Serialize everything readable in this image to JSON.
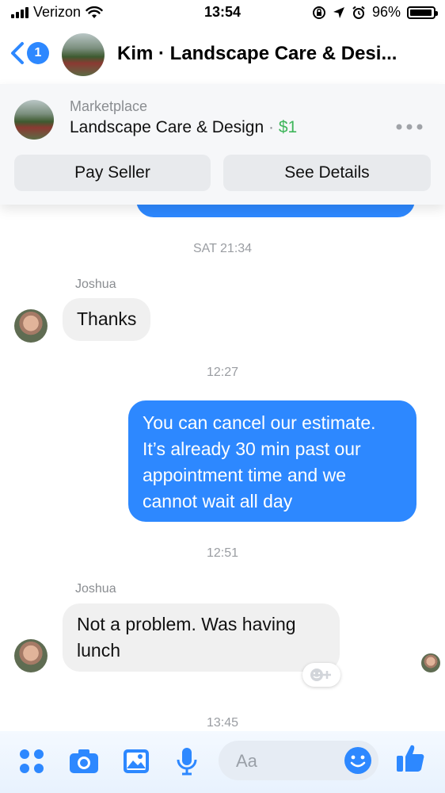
{
  "status_bar": {
    "carrier": "Verizon",
    "time": "13:54",
    "battery": "96%",
    "battery_level": 0.96
  },
  "header": {
    "unread_badge": "1",
    "title": "Kim · Landscape Care & Desi..."
  },
  "marketplace": {
    "label": "Marketplace",
    "item": "Landscape Care & Design",
    "separator": "·",
    "price": "$1",
    "pay_label": "Pay Seller",
    "details_label": "See Details"
  },
  "messages": {
    "ts1": "SAT 21:34",
    "sender1": "Joshua",
    "msg1": "Thanks",
    "ts2": "12:27",
    "msg2": "You can cancel our estimate. It’s already 30 min past our appointment time and we cannot wait all day",
    "ts3": "12:51",
    "sender2": "Joshua",
    "msg3": "Not a problem.  Was having lunch",
    "ts4": "13:45"
  },
  "composer": {
    "placeholder": "Aa"
  },
  "colors": {
    "accent": "#2d88ff",
    "price": "#3fb65b"
  },
  "icons": [
    "wifi-icon",
    "lock-rotation-icon",
    "location-arrow-icon",
    "alarm-icon",
    "back-chevron-icon",
    "more-icon",
    "apps-icon",
    "camera-icon",
    "gallery-icon",
    "mic-icon",
    "emoji-icon",
    "like-icon",
    "add-reaction-icon"
  ]
}
